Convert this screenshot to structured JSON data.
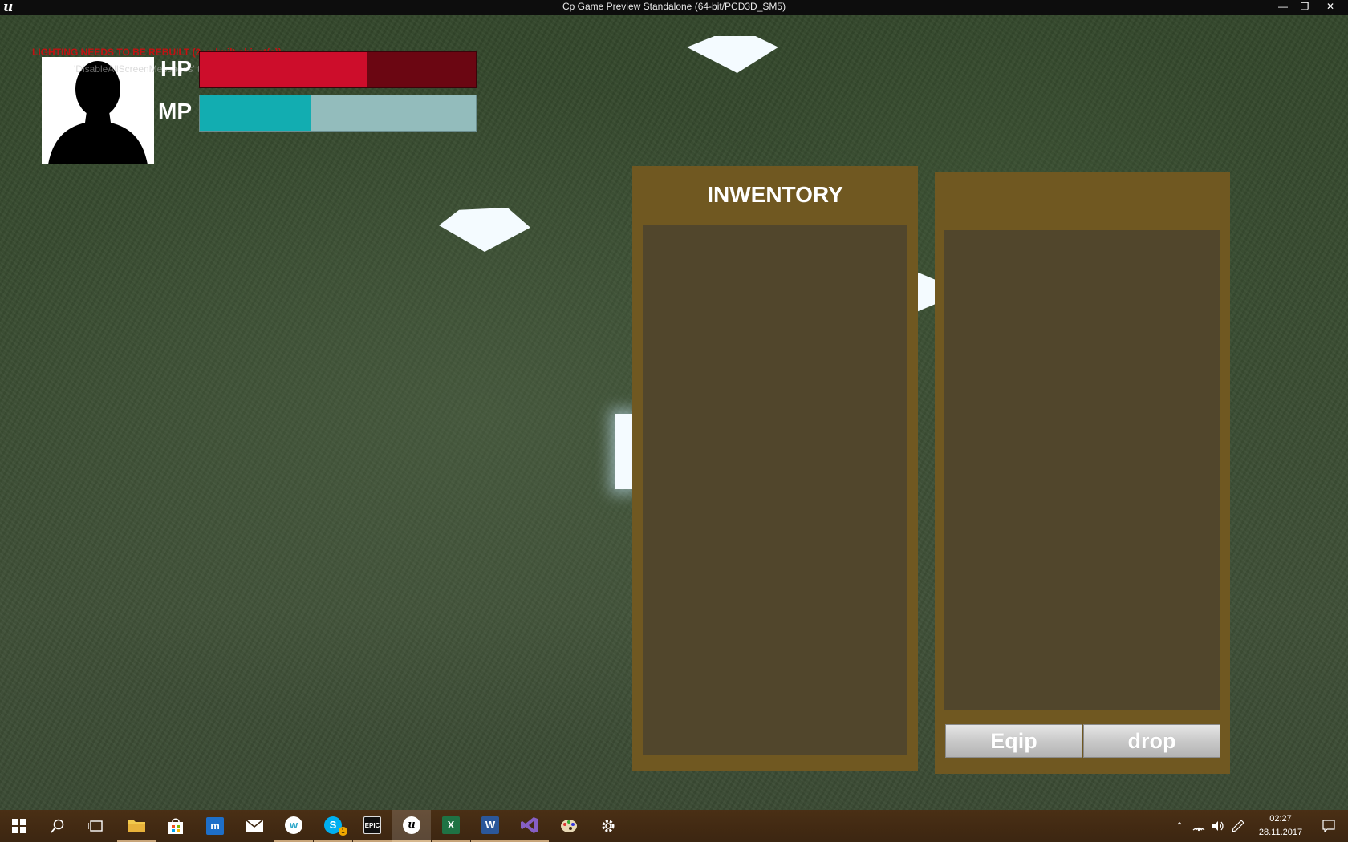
{
  "window": {
    "title": "Cp Game Preview Standalone (64-bit/PCD3D_SM5)",
    "minimize_icon": "minimize-icon",
    "restore_icon": "restore-icon",
    "close_icon": "close-icon"
  },
  "hud": {
    "debug_warning": "LIGHTING NEEDS TO BE REBUILT (2 unbuilt object(s))",
    "debug_hint": "'DisableAllScreenMessages' to suppress",
    "hp": {
      "label": "HP",
      "fraction": 0.605,
      "color": "#cd0d2b"
    },
    "mp": {
      "label": "MP",
      "fraction": 0.4,
      "color": "#12adb1"
    }
  },
  "inventory": {
    "title": "INWENTORY",
    "equip_label": "Eqip",
    "drop_label": "drop"
  },
  "taskbar": {
    "apps": [
      {
        "icon": "windows-start-icon"
      },
      {
        "icon": "search-icon"
      },
      {
        "icon": "task-view-icon"
      },
      {
        "icon": "file-explorer-icon"
      },
      {
        "icon": "store-icon"
      },
      {
        "icon": "maxthon-icon"
      },
      {
        "icon": "mail-icon"
      },
      {
        "icon": "browser-w-icon"
      },
      {
        "icon": "skype-icon",
        "badge": "1"
      },
      {
        "icon": "epic-games-icon",
        "label": "EPIC"
      },
      {
        "icon": "unreal-engine-icon"
      },
      {
        "icon": "excel-icon",
        "label": "X"
      },
      {
        "icon": "word-icon",
        "label": "W"
      },
      {
        "icon": "visual-studio-icon"
      },
      {
        "icon": "paint-icon"
      },
      {
        "icon": "settings-gear-icon"
      }
    ],
    "clock_time": "02:27",
    "clock_date": "28.11.2017"
  },
  "colors": {
    "panel": "#705821",
    "slot_area": "#51462c",
    "hp_bg": "#6b0612",
    "mp_bg": "#93bcbc",
    "taskbar": "#3c2611"
  }
}
